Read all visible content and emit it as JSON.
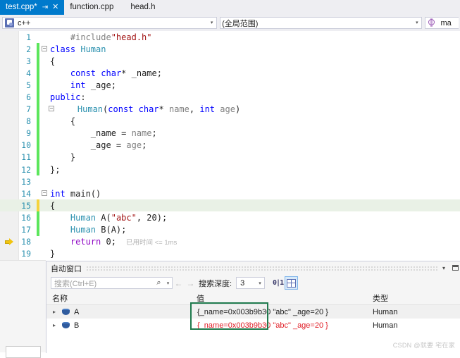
{
  "tabs": [
    {
      "label": "test.cpp*",
      "active": true,
      "pin_icon": "pin-icon",
      "close_icon": "close-icon"
    },
    {
      "label": "function.cpp",
      "active": false
    },
    {
      "label": "head.h",
      "active": false
    }
  ],
  "navbar": {
    "project_combo": {
      "icon": "puzzle-icon",
      "value": "c++",
      "arrow": "▾"
    },
    "scope_combo": {
      "value": "(全局范围)",
      "arrow": "▾"
    },
    "member_combo": {
      "icon": "method-cube-icon",
      "value": "ma",
      "arrow": "▾"
    }
  },
  "editor": {
    "lines": [
      {
        "n": "1",
        "change": "none",
        "fold": "",
        "highlight": false,
        "tokens": [
          {
            "t": "    ",
            "c": "id"
          },
          {
            "t": "#include",
            "c": "pp"
          },
          {
            "t": "\"head.h\"",
            "c": "str"
          }
        ]
      },
      {
        "n": "2",
        "change": "green",
        "fold": "minus",
        "highlight": false,
        "tokens": [
          {
            "t": "class",
            "c": "k"
          },
          {
            "t": " ",
            "c": "id"
          },
          {
            "t": "Human",
            "c": "typ"
          }
        ]
      },
      {
        "n": "3",
        "change": "green",
        "fold": "line",
        "highlight": false,
        "tokens": [
          {
            "t": "{",
            "c": "id"
          }
        ]
      },
      {
        "n": "4",
        "change": "green",
        "fold": "line",
        "highlight": false,
        "tokens": [
          {
            "t": "    ",
            "c": "id"
          },
          {
            "t": "const",
            "c": "k"
          },
          {
            "t": " ",
            "c": "id"
          },
          {
            "t": "char",
            "c": "k"
          },
          {
            "t": "* _name;",
            "c": "id"
          }
        ]
      },
      {
        "n": "5",
        "change": "green",
        "fold": "line",
        "highlight": false,
        "tokens": [
          {
            "t": "    ",
            "c": "id"
          },
          {
            "t": "int",
            "c": "k"
          },
          {
            "t": " _age;",
            "c": "id"
          }
        ]
      },
      {
        "n": "6",
        "change": "green",
        "fold": "line",
        "highlight": false,
        "tokens": [
          {
            "t": "public",
            "c": "k"
          },
          {
            "t": ":",
            "c": "id"
          }
        ]
      },
      {
        "n": "7",
        "change": "green",
        "fold": "minus2",
        "highlight": false,
        "tokens": [
          {
            "t": "    ",
            "c": "id"
          },
          {
            "t": "Human",
            "c": "typ"
          },
          {
            "t": "(",
            "c": "id"
          },
          {
            "t": "const",
            "c": "k"
          },
          {
            "t": " ",
            "c": "id"
          },
          {
            "t": "char",
            "c": "k"
          },
          {
            "t": "* ",
            "c": "id"
          },
          {
            "t": "name",
            "c": "par"
          },
          {
            "t": ", ",
            "c": "id"
          },
          {
            "t": "int",
            "c": "k"
          },
          {
            "t": " ",
            "c": "id"
          },
          {
            "t": "age",
            "c": "par"
          },
          {
            "t": ")",
            "c": "id"
          }
        ]
      },
      {
        "n": "8",
        "change": "green",
        "fold": "line2",
        "highlight": false,
        "tokens": [
          {
            "t": "    {",
            "c": "id"
          }
        ]
      },
      {
        "n": "9",
        "change": "green",
        "fold": "line2",
        "highlight": false,
        "tokens": [
          {
            "t": "        _name = ",
            "c": "id"
          },
          {
            "t": "name",
            "c": "par"
          },
          {
            "t": ";",
            "c": "id"
          }
        ]
      },
      {
        "n": "10",
        "change": "green",
        "fold": "line2",
        "highlight": false,
        "tokens": [
          {
            "t": "        _age = ",
            "c": "id"
          },
          {
            "t": "age",
            "c": "par"
          },
          {
            "t": ";",
            "c": "id"
          }
        ]
      },
      {
        "n": "11",
        "change": "green",
        "fold": "line2",
        "highlight": false,
        "tokens": [
          {
            "t": "    }",
            "c": "id"
          }
        ]
      },
      {
        "n": "12",
        "change": "green",
        "fold": "end",
        "highlight": false,
        "tokens": [
          {
            "t": "};",
            "c": "id"
          }
        ]
      },
      {
        "n": "13",
        "change": "none",
        "fold": "",
        "highlight": false,
        "tokens": [
          {
            "t": "",
            "c": "id"
          }
        ]
      },
      {
        "n": "14",
        "change": "none",
        "fold": "minus",
        "highlight": false,
        "tokens": [
          {
            "t": "int",
            "c": "k"
          },
          {
            "t": " ",
            "c": "id"
          },
          {
            "t": "main",
            "c": "id"
          },
          {
            "t": "()",
            "c": "id"
          }
        ]
      },
      {
        "n": "15",
        "change": "yellow",
        "fold": "line",
        "highlight": true,
        "tokens": [
          {
            "t": "{",
            "c": "id"
          }
        ]
      },
      {
        "n": "16",
        "change": "green",
        "fold": "line",
        "highlight": false,
        "tokens": [
          {
            "t": "    ",
            "c": "id"
          },
          {
            "t": "Human",
            "c": "typ"
          },
          {
            "t": " A(",
            "c": "id"
          },
          {
            "t": "\"abc\"",
            "c": "str"
          },
          {
            "t": ", ",
            "c": "id"
          },
          {
            "t": "20",
            "c": "num"
          },
          {
            "t": ");",
            "c": "id"
          }
        ]
      },
      {
        "n": "17",
        "change": "green",
        "fold": "line",
        "highlight": false,
        "tokens": [
          {
            "t": "    ",
            "c": "id"
          },
          {
            "t": "Human",
            "c": "typ"
          },
          {
            "t": " B(A);",
            "c": "id"
          }
        ]
      },
      {
        "n": "18",
        "change": "none",
        "fold": "line",
        "highlight": false,
        "exec": true,
        "tokens": [
          {
            "t": "    ",
            "c": "id"
          },
          {
            "t": "return",
            "c": "ctrl"
          },
          {
            "t": " ",
            "c": "id"
          },
          {
            "t": "0",
            "c": "num"
          },
          {
            "t": ";",
            "c": "id"
          }
        ],
        "annotation": "已用时间 <= 1ms"
      },
      {
        "n": "19",
        "change": "none",
        "fold": "end",
        "highlight": false,
        "tokens": [
          {
            "t": "}",
            "c": "id"
          }
        ]
      }
    ]
  },
  "autos": {
    "title": "自动窗口",
    "dropdown_icon": "chevron-down-icon",
    "window_icon": "window-maximize-icon",
    "search": {
      "placeholder": "搜索(Ctrl+E)",
      "value": "",
      "icon": "search-icon",
      "arrow": "▾"
    },
    "back_arrow": "←",
    "forward_arrow": "→",
    "depth_label": "搜索深度:",
    "depth_value": "3",
    "depth_arrow": "▾",
    "btn_hex": "hex-display-icon",
    "btn_grid": "grid-view-icon",
    "columns": [
      "名称",
      "值",
      "类型"
    ],
    "rows": [
      {
        "name": "A",
        "value": "{_name=0x003b9b30 \"abc\" _age=20 }",
        "type": "Human",
        "changed": false,
        "expander": "▸",
        "icon": "object-icon"
      },
      {
        "name": "B",
        "value": "{_name=0x003b9b30 \"abc\" _age=20 }",
        "type": "Human",
        "changed": true,
        "expander": "▸",
        "icon": "object-icon"
      }
    ]
  },
  "watermark": "CSDN @就要 宅在家",
  "stub_text": "",
  "colors": {
    "accent": "#007acc",
    "change_green": "#5ce65c",
    "change_yellow": "#f5d33b",
    "highlight_rect": "#1f7a4d",
    "changed_value": "#e01b24",
    "keyword": "#0000ff",
    "string": "#a31515",
    "type": "#2b91af",
    "line_number": "#2b91af"
  }
}
